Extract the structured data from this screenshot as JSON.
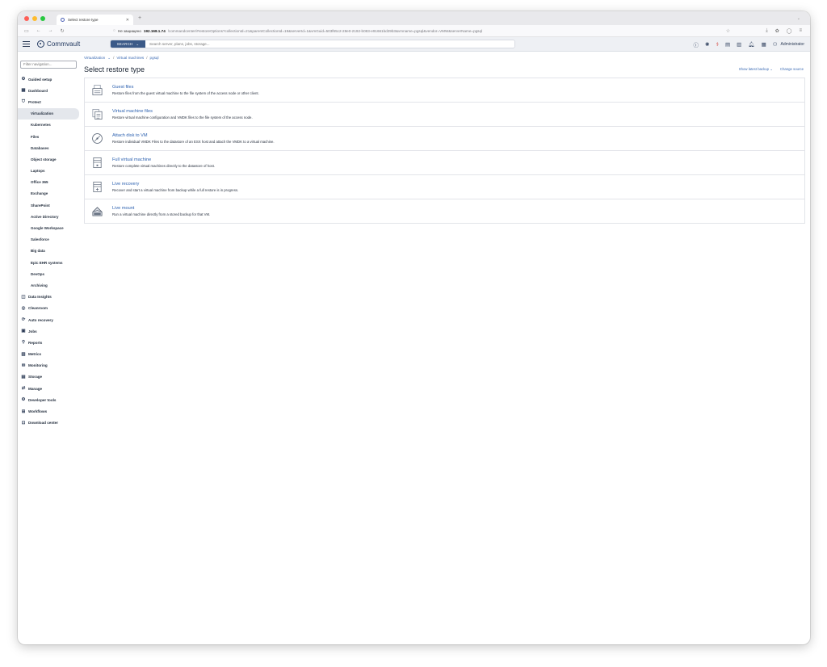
{
  "browser": {
    "tab_title": "Select restore type",
    "new_tab": "+",
    "not_secure": "Не защищено",
    "url_host": "192.168.1.74",
    "url_path": "/commandcenter/#restoreOptions?collectionId=21&parentCollectionId=19&serverId=1&vmGuid=503f65c2-28e0-2192-b083-e91661bd29b3&vmname=pgsql&vendor=VMW&serverName=pgsql"
  },
  "header": {
    "logo_text": "Commvault",
    "search_button": "SEARCH",
    "search_placeholder": "Search server, plans, jobs, storage...",
    "user": "Administrator"
  },
  "sidebar": {
    "filter_placeholder": "Filter navigation...",
    "items": [
      {
        "label": "Guided setup",
        "icon": "gear-icon"
      },
      {
        "label": "Dashboard",
        "icon": "dashboard-icon"
      },
      {
        "label": "Protect",
        "icon": "protect-icon"
      },
      {
        "label": "Virtualization",
        "sub": true,
        "active": true
      },
      {
        "label": "Kubernetes",
        "sub": true
      },
      {
        "label": "Files",
        "sub": true
      },
      {
        "label": "Databases",
        "sub": true
      },
      {
        "label": "Object storage",
        "sub": true
      },
      {
        "label": "Laptops",
        "sub": true
      },
      {
        "label": "Office 365",
        "sub": true
      },
      {
        "label": "Exchange",
        "sub": true
      },
      {
        "label": "SharePoint",
        "sub": true
      },
      {
        "label": "Active Directory",
        "sub": true
      },
      {
        "label": "Google Workspace",
        "sub": true
      },
      {
        "label": "Salesforce",
        "sub": true
      },
      {
        "label": "Big data",
        "sub": true
      },
      {
        "label": "Epic EHR systems",
        "sub": true
      },
      {
        "label": "DevOps",
        "sub": true
      },
      {
        "label": "Archiving",
        "sub": true
      },
      {
        "label": "Data Insights",
        "icon": "insights-icon"
      },
      {
        "label": "Cleanroom",
        "icon": "cleanroom-icon"
      },
      {
        "label": "Auto recovery",
        "icon": "auto-recovery-icon"
      },
      {
        "label": "Jobs",
        "icon": "jobs-icon"
      },
      {
        "label": "Reports",
        "icon": "reports-icon"
      },
      {
        "label": "Metrics",
        "icon": "metrics-icon"
      },
      {
        "label": "Monitoring",
        "icon": "monitoring-icon"
      },
      {
        "label": "Storage",
        "icon": "storage-icon"
      },
      {
        "label": "Manage",
        "icon": "manage-icon"
      },
      {
        "label": "Developer tools",
        "icon": "developer-tools-icon"
      },
      {
        "label": "Workflows",
        "icon": "workflows-icon"
      },
      {
        "label": "Download center",
        "icon": "download-icon"
      }
    ]
  },
  "breadcrumb": {
    "first": "Virtualization",
    "second": "Virtual machines",
    "third": "pgsql",
    "sep": "/"
  },
  "page": {
    "title": "Select restore type",
    "action_latest": "Show latest backup",
    "action_source": "Change source"
  },
  "options": [
    {
      "title": "Guest files",
      "desc": "Restore files from the guest virtual machine to the file system of the access node or other client.",
      "icon": "guest-files-icon"
    },
    {
      "title": "Virtual machine files",
      "desc": "Restore virtual machine configuration and VMDK files to the file system of the access node.",
      "icon": "vm-files-icon"
    },
    {
      "title": "Attach disk to VM",
      "desc": "Restore individual VMDK Files to the datastore of an ESX host and attach the VMDK to a virtual machine.",
      "icon": "attach-disk-icon"
    },
    {
      "title": "Full virtual machine",
      "desc": "Restore complete virtual machines directly to the datastore of host.",
      "icon": "full-vm-icon"
    },
    {
      "title": "Live recovery",
      "desc": "Recover and start a virtual machine from backup while a full restore is in progress.",
      "icon": "live-recovery-icon"
    },
    {
      "title": "Live mount",
      "desc": "Run a virtual machine directly from a stored backup for that VM.",
      "icon": "live-mount-icon"
    }
  ]
}
